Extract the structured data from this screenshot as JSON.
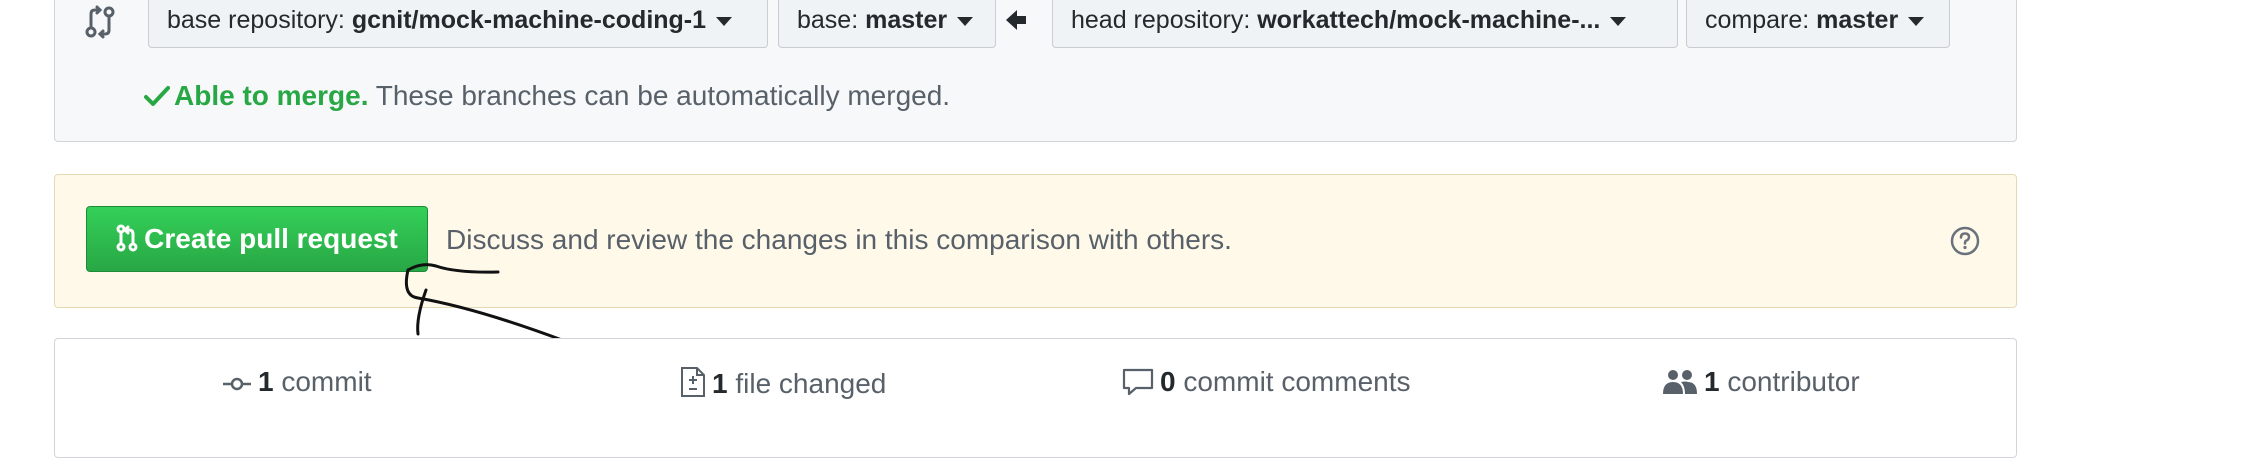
{
  "range": {
    "base_repo": {
      "label": "base repository: ",
      "value": "gcnit/mock-machine-coding-1"
    },
    "base": {
      "label": "base: ",
      "value": "master"
    },
    "head_repo": {
      "label": "head repository: ",
      "value": "workattech/mock-machine-..."
    },
    "compare": {
      "label": "compare: ",
      "value": "master"
    },
    "merge_status": {
      "ok": "Able to merge.",
      "message": " These branches can be automatically merged."
    }
  },
  "pull_request": {
    "create_label": "Create pull request",
    "description": "Discuss and review the changes in this comparison with others."
  },
  "stats": {
    "commits": {
      "count": "1",
      "label": " commit"
    },
    "files": {
      "count": "1",
      "label": " file changed"
    },
    "comments": {
      "count": "0",
      "label": " commit comments"
    },
    "contributors": {
      "count": "1",
      "label": " contributor"
    }
  },
  "colors": {
    "accent": "#28a745",
    "notice_bg": "#fff9ea",
    "range_bg": "#f6f8fa"
  },
  "icons": [
    "git-compare-icon",
    "triangle-left-icon",
    "check-icon",
    "git-pull-request-icon",
    "question-icon",
    "git-commit-icon",
    "file-diff-icon",
    "comment-icon",
    "people-icon"
  ]
}
